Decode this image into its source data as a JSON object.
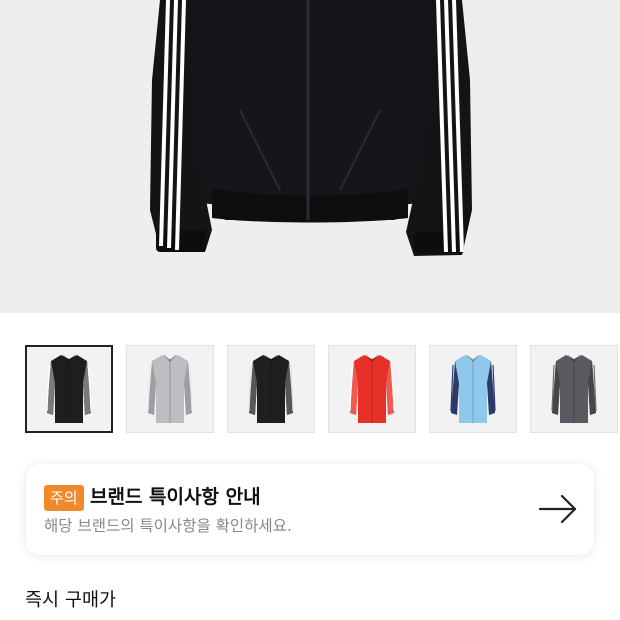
{
  "product": {
    "main_image": "black-track-jacket-with-white-three-stripes"
  },
  "variants": [
    {
      "name": "black-track-jacket",
      "body": "#1e1e20",
      "sleeve": "#7a7a7c",
      "stripe": "#ffffff",
      "selected": true
    },
    {
      "name": "gray-track-jacket",
      "body": "#bdbdc2",
      "sleeve": "#9d9da3",
      "stripe": "#e8e8ec",
      "selected": false
    },
    {
      "name": "black-track-jacket-alt",
      "body": "#1f1f21",
      "sleeve": "#55565a",
      "stripe": "#e0e0e0",
      "selected": false
    },
    {
      "name": "red-track-jacket",
      "body": "#e8302a",
      "sleeve": "#ef5a4e",
      "stripe": "#ffffff",
      "selected": false
    },
    {
      "name": "sky-blue-track-jacket",
      "body": "#8ec8ea",
      "sleeve": "#2a3a6a",
      "stripe": "#2a3a6a",
      "selected": false
    },
    {
      "name": "charcoal-track-jacket",
      "body": "#5a5b60",
      "sleeve": "#45464a",
      "stripe": "#6e6f74",
      "selected": false
    }
  ],
  "notice": {
    "badge": "주의",
    "title": "브랜드 특이사항 안내",
    "description": "해당 브랜드의 특이사항을 확인하세요.",
    "arrow_icon": "arrow-right-icon",
    "badge_color": "#f0882c"
  },
  "section": {
    "instant_buy_label": "즉시 구매가"
  }
}
